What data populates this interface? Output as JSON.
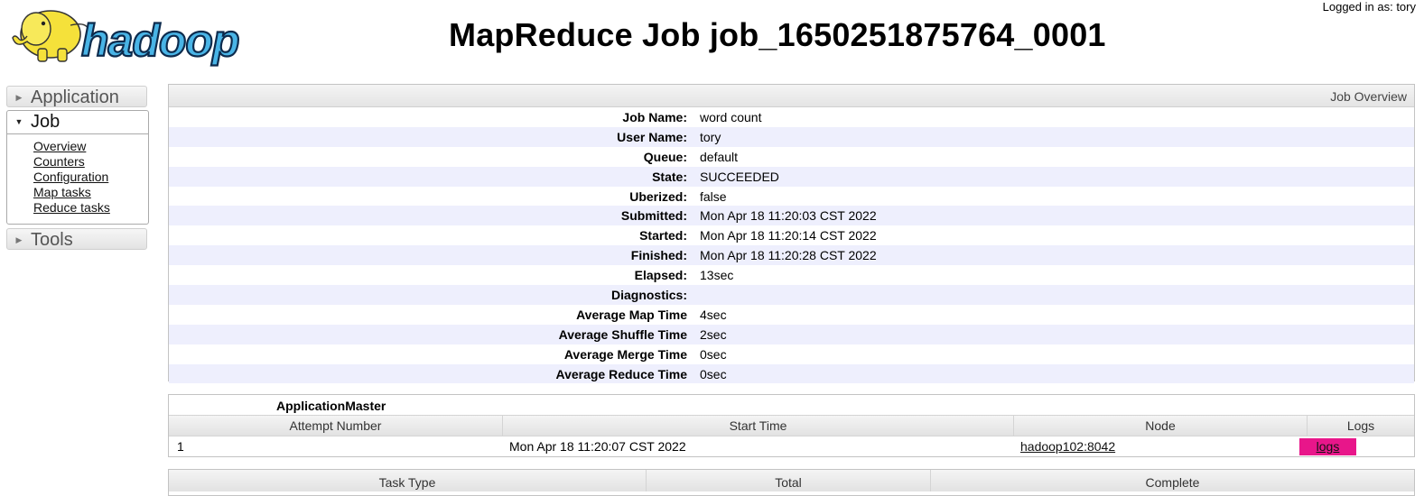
{
  "header": {
    "title": "MapReduce Job job_1650251875764_0001",
    "logged_in": "Logged in as: tory",
    "logo_text": "hadoop"
  },
  "sidebar": {
    "application_label": "Application",
    "job_label": "Job",
    "job_items": [
      "Overview",
      "Counters",
      "Configuration",
      "Map tasks",
      "Reduce tasks"
    ],
    "tools_label": "Tools"
  },
  "overview": {
    "heading": "Job Overview",
    "rows": [
      {
        "key": "Job Name:",
        "value": "word count"
      },
      {
        "key": "User Name:",
        "value": "tory"
      },
      {
        "key": "Queue:",
        "value": "default"
      },
      {
        "key": "State:",
        "value": "SUCCEEDED"
      },
      {
        "key": "Uberized:",
        "value": "false"
      },
      {
        "key": "Submitted:",
        "value": "Mon Apr 18 11:20:03 CST 2022"
      },
      {
        "key": "Started:",
        "value": "Mon Apr 18 11:20:14 CST 2022"
      },
      {
        "key": "Finished:",
        "value": "Mon Apr 18 11:20:28 CST 2022"
      },
      {
        "key": "Elapsed:",
        "value": "13sec"
      },
      {
        "key": "Diagnostics:",
        "value": ""
      },
      {
        "key": "Average Map Time",
        "value": "4sec"
      },
      {
        "key": "Average Shuffle Time",
        "value": "2sec"
      },
      {
        "key": "Average Merge Time",
        "value": "0sec"
      },
      {
        "key": "Average Reduce Time",
        "value": "0sec"
      }
    ]
  },
  "application_master": {
    "caption": "ApplicationMaster",
    "columns": [
      "Attempt Number",
      "Start Time",
      "Node",
      "Logs"
    ],
    "row": {
      "attempt": "1",
      "start_time": "Mon Apr 18 11:20:07 CST 2022",
      "node": "hadoop102:8042",
      "logs": "logs"
    }
  },
  "tasks": {
    "columns": [
      "Task Type",
      "Total",
      "Complete"
    ]
  },
  "colors": {
    "stripe": "#eeeffd",
    "logs_highlight": "#e8168a",
    "logo_blue": "#1a6fb5",
    "logo_yellow": "#f5e13a"
  }
}
